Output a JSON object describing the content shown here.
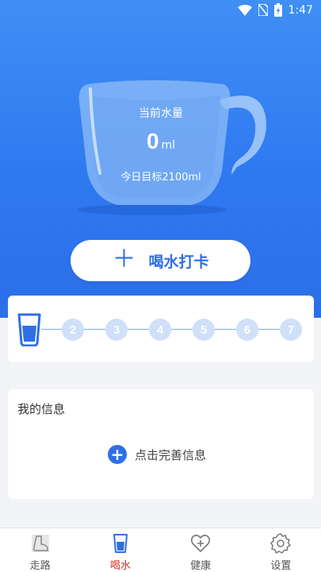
{
  "status_bar": {
    "time": "1:47"
  },
  "cup": {
    "label": "当前水量",
    "amount": "0",
    "unit": "ml",
    "target": "今日目标2100ml"
  },
  "checkin_button": {
    "label": "喝水打卡"
  },
  "progress": {
    "steps": [
      "2",
      "3",
      "4",
      "5",
      "6",
      "7"
    ],
    "completed": 0
  },
  "info_card": {
    "title": "我的信息",
    "action_label": "点击完善信息"
  },
  "tabs": [
    {
      "label": "走路",
      "icon": "shoe-icon"
    },
    {
      "label": "喝水",
      "icon": "cup-icon"
    },
    {
      "label": "健康",
      "icon": "heart-plus-icon"
    },
    {
      "label": "设置",
      "icon": "gear-icon"
    }
  ],
  "colors": {
    "accent": "#2f6fe6",
    "active_tab": "#d9281e",
    "step_inactive": "#cfe0f8"
  }
}
